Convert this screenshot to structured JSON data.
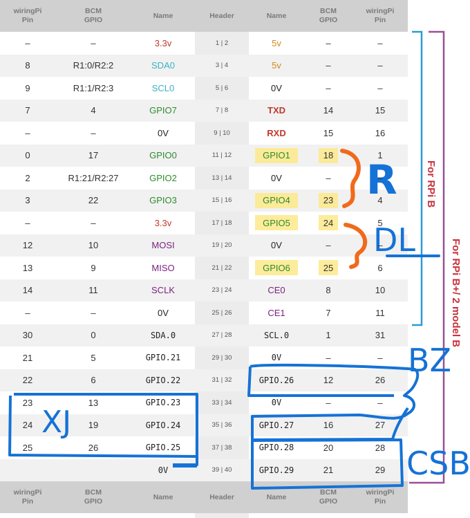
{
  "columns": [
    "wiringPi\nPin",
    "BCM\nGPIO",
    "Name",
    "Header",
    "Name",
    "BCM\nGPIO",
    "wiringPi\nPin"
  ],
  "rows": [
    [
      "–",
      "–",
      "3.3v",
      "1 | 2",
      "5v",
      "–",
      "–"
    ],
    [
      "8",
      "R1:0/R2:2",
      "SDA0",
      "3 | 4",
      "5v",
      "–",
      "–"
    ],
    [
      "9",
      "R1:1/R2:3",
      "SCL0",
      "5 | 6",
      "0V",
      "–",
      "–"
    ],
    [
      "7",
      "4",
      "GPIO7",
      "7 | 8",
      "TXD",
      "14",
      "15"
    ],
    [
      "–",
      "–",
      "0V",
      "9 | 10",
      "RXD",
      "15",
      "16"
    ],
    [
      "0",
      "17",
      "GPIO0",
      "11 | 12",
      "GPIO1",
      "18",
      "1"
    ],
    [
      "2",
      "R1:21/R2:27",
      "GPIO2",
      "13 | 14",
      "0V",
      "–",
      "–"
    ],
    [
      "3",
      "22",
      "GPIO3",
      "15 | 16",
      "GPIO4",
      "23",
      "4"
    ],
    [
      "–",
      "–",
      "3.3v",
      "17 | 18",
      "GPIO5",
      "24",
      "5"
    ],
    [
      "12",
      "10",
      "MOSI",
      "19 | 20",
      "0V",
      "–",
      "–"
    ],
    [
      "13",
      "9",
      "MISO",
      "21 | 22",
      "GPIO6",
      "25",
      "6"
    ],
    [
      "14",
      "11",
      "SCLK",
      "23 | 24",
      "CE0",
      "8",
      "10"
    ],
    [
      "–",
      "–",
      "0V",
      "25 | 26",
      "CE1",
      "7",
      "11"
    ],
    [
      "30",
      "0",
      "SDA.0",
      "27 | 28",
      "SCL.0",
      "1",
      "31"
    ],
    [
      "21",
      "5",
      "GPIO.21",
      "29 | 30",
      "0V",
      "–",
      "–"
    ],
    [
      "22",
      "6",
      "GPIO.22",
      "31 | 32",
      "GPIO.26",
      "12",
      "26"
    ],
    [
      "23",
      "13",
      "GPIO.23",
      "33 | 34",
      "0V",
      "–",
      "–"
    ],
    [
      "24",
      "19",
      "GPIO.24",
      "35 | 36",
      "GPIO.27",
      "16",
      "27"
    ],
    [
      "25",
      "26",
      "GPIO.25",
      "37 | 38",
      "GPIO.28",
      "20",
      "28"
    ],
    [
      "",
      "",
      "0V",
      "39 | 40",
      "GPIO.29",
      "21",
      "29"
    ]
  ],
  "colors": {
    "power33": "#c0392b",
    "power5": "#d48a1a",
    "i2c": "#3bb3c3",
    "gpio": "#2e8b2e",
    "spi": "#7b1f7b",
    "uart": "#c0392b",
    "ground": "#222222",
    "highlight": "#fde98a",
    "annotation_blue": "#1572d6",
    "annotation_orange": "#f06a1c",
    "bracket_cyan": "#2b9bd6",
    "bracket_purple": "#9b4f96"
  },
  "annotations": {
    "for_rpi_b": "For RPi B",
    "for_rpi_bplus": "For RPi B+/ 2 model B",
    "hand_r": "R",
    "hand_dl": "DL",
    "hand_bz": "BZ",
    "hand_xj": "XJ",
    "hand_csb": "CSB"
  }
}
